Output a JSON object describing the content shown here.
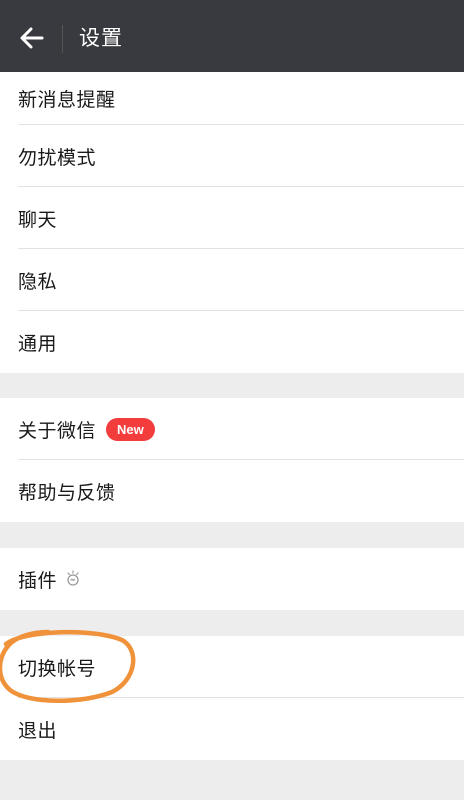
{
  "header": {
    "title": "设置",
    "background": "#393a3f"
  },
  "groups": [
    {
      "items": [
        {
          "label": "新消息提醒"
        },
        {
          "label": "勿扰模式"
        },
        {
          "label": "聊天"
        },
        {
          "label": "隐私"
        },
        {
          "label": "通用"
        }
      ]
    },
    {
      "items": [
        {
          "label": "关于微信",
          "badge": "New"
        },
        {
          "label": "帮助与反馈"
        }
      ]
    },
    {
      "items": [
        {
          "label": "插件",
          "icon": "plugin-bulb-icon"
        }
      ]
    },
    {
      "items": [
        {
          "label": "切换帐号",
          "annotation": "orange-circle"
        },
        {
          "label": "退出"
        }
      ]
    }
  ],
  "colors": {
    "badge": "#f33d3d",
    "annotation": "#f0923a",
    "page_background": "#ededed"
  }
}
